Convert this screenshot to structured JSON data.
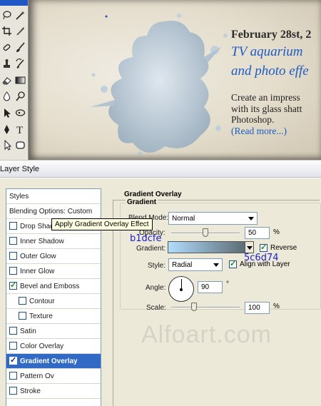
{
  "canvas": {
    "article": {
      "date": "February 28st, 2",
      "title_line1": "TV aquarium",
      "title_line2": "and photo effe",
      "body_line1": "Create an impress",
      "body_line2": "with its glass shatt",
      "body_line3": "Photoshop.",
      "read_more": "(Read more...)"
    }
  },
  "dialog": {
    "title": "Layer Style",
    "styles_list": [
      {
        "label": "Styles",
        "checkbox": false
      },
      {
        "label": "Blending Options: Custom",
        "checkbox": false
      },
      {
        "label": "Drop Shadow",
        "checkbox": true,
        "checked": false
      },
      {
        "label": "Inner Shadow",
        "checkbox": true,
        "checked": false
      },
      {
        "label": "Outer Glow",
        "checkbox": true,
        "checked": false
      },
      {
        "label": "Inner Glow",
        "checkbox": true,
        "checked": false
      },
      {
        "label": "Bevel and Emboss",
        "checkbox": true,
        "checked": true
      },
      {
        "label": "Contour",
        "checkbox": true,
        "checked": false,
        "indent": true
      },
      {
        "label": "Texture",
        "checkbox": true,
        "checked": false,
        "indent": true
      },
      {
        "label": "Satin",
        "checkbox": true,
        "checked": false
      },
      {
        "label": "Color Overlay",
        "checkbox": true,
        "checked": false
      },
      {
        "label": "Gradient Overlay",
        "checkbox": true,
        "checked": true,
        "selected": true
      },
      {
        "label": "Pattern Ov",
        "checkbox": true,
        "checked": false
      },
      {
        "label": "Stroke",
        "checkbox": true,
        "checked": false
      }
    ],
    "tooltip": "Apply Gradient Overlay Effect",
    "panel": {
      "section_title": "Gradient Overlay",
      "group_title": "Gradient",
      "blend_mode_label": "Blend Mode:",
      "blend_mode_value": "Normal",
      "opacity_label": "Opacity:",
      "opacity_value": "50",
      "opacity_fraction": 0.5,
      "gradient_label": "Gradient:",
      "gradient_start_color": "#b1dcfe",
      "gradient_end_color": "#5c6d74",
      "gradient_start_annotation": "b1dcfe",
      "gradient_end_annotation": "5c6d74",
      "reverse_label": "Reverse",
      "reverse_checked": true,
      "style_label": "Style:",
      "style_value": "Radial",
      "align_label": "Align with Layer",
      "align_checked": true,
      "angle_label": "Angle:",
      "angle_value": "90",
      "angle_unit": "°",
      "scale_label": "Scale:",
      "scale_value": "100",
      "scale_fraction": 0.333,
      "percent_unit": "%"
    },
    "watermark": "Alfoart.com"
  },
  "colors": {
    "accent_link": "#1d5cc0",
    "selection": "#316ac5",
    "annotation": "#1f1fd0"
  }
}
